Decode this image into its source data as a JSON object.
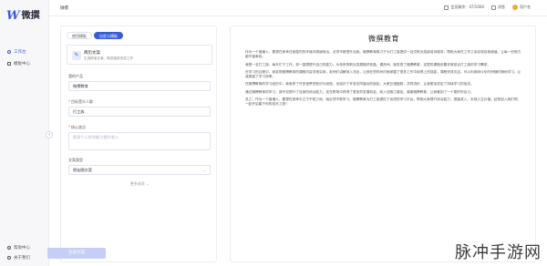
{
  "app": {
    "logo_mark": "W",
    "logo_text": "微撰"
  },
  "sidebar": {
    "items": [
      {
        "label": "工作台",
        "active": true
      },
      {
        "label": "模板中心",
        "active": false
      }
    ],
    "bottom_items": [
      {
        "label": "帮助中心"
      },
      {
        "label": "关于我们"
      }
    ],
    "collapse_glyph": "‹"
  },
  "header": {
    "title": "微撰",
    "right": [
      {
        "label": "会员剩余：47/1000"
      },
      {
        "label": "消息"
      },
      {
        "label": "用户名"
      }
    ]
  },
  "form": {
    "tabs": [
      {
        "label": "使用模板",
        "active": false
      },
      {
        "label": "自定义模板",
        "active": true
      }
    ],
    "template": {
      "icon": "✎",
      "name": "简历文案",
      "desc": "生成精准文案，助您高效完成工作"
    },
    "fields": [
      {
        "label": "我的产品",
        "value": "微撰教育",
        "placeholder": "",
        "required": false
      },
      {
        "label": "目标受众人群",
        "value": "打工族",
        "placeholder": "",
        "required": true
      },
      {
        "label": "核心卖点",
        "value": "",
        "placeholder": "提高个人综合能力提升收入",
        "required": true
      },
      {
        "label": "文案类型",
        "value": "朋友圈文案",
        "placeholder": "",
        "required": false
      }
    ],
    "more_label": "更多选项 ⌄",
    "generate_label": "生成文案"
  },
  "document": {
    "title": "微撰教育",
    "paragraphs": [
      "作为一个普通人，要想在竞争日趋激烈的环境中脱颖而出，必须不断提升自我。微撰教育致力于为打工族提供一站式职业技能培训服务，帮助大家在工作之余实现自我增值，让每一份努力都不被辜负。",
      "我是一名打工族，每天忙于工作，却一直想提升自己的能力，为将来的职业发展做好准备。偶然间，我发现了微撰教育，这里的课程设置非常贴合打工族的学习需求。",
      "在学习的过程中，我发现微撰教育的课程内容非常实用，老师们讲解深入浅出，让我在短时间内就掌握了很多工作中用得上的技能。课程安排灵活，可以利用碎片化时间随时随地学习，让我提高了学习效率。",
      "在微撰教育的学习经历中，我收获了许多宝贵的知识与经验，也结识了许多志同道合的朋友。大家互相鼓励，共同进步，让我更加坚定了持续学习的信念。",
      "通过微撰教育的学习，我不仅提升了自身的综合能力，还在职场中获得了更多的发展机会，收入也随之增加。感谢微撰教育，让我看到了一个更好的自己。",
      "总之，作为一个普通人，要想在竞争中立于不败之地，就必须不断学习。微撰教育为打工族提供了优质的学习平台，帮助大家提升综合能力，提高收入，实现人生价值。赶快加入我们吧，一起开启属于你的成长之旅！"
    ]
  },
  "watermark": "脉冲手游网"
}
